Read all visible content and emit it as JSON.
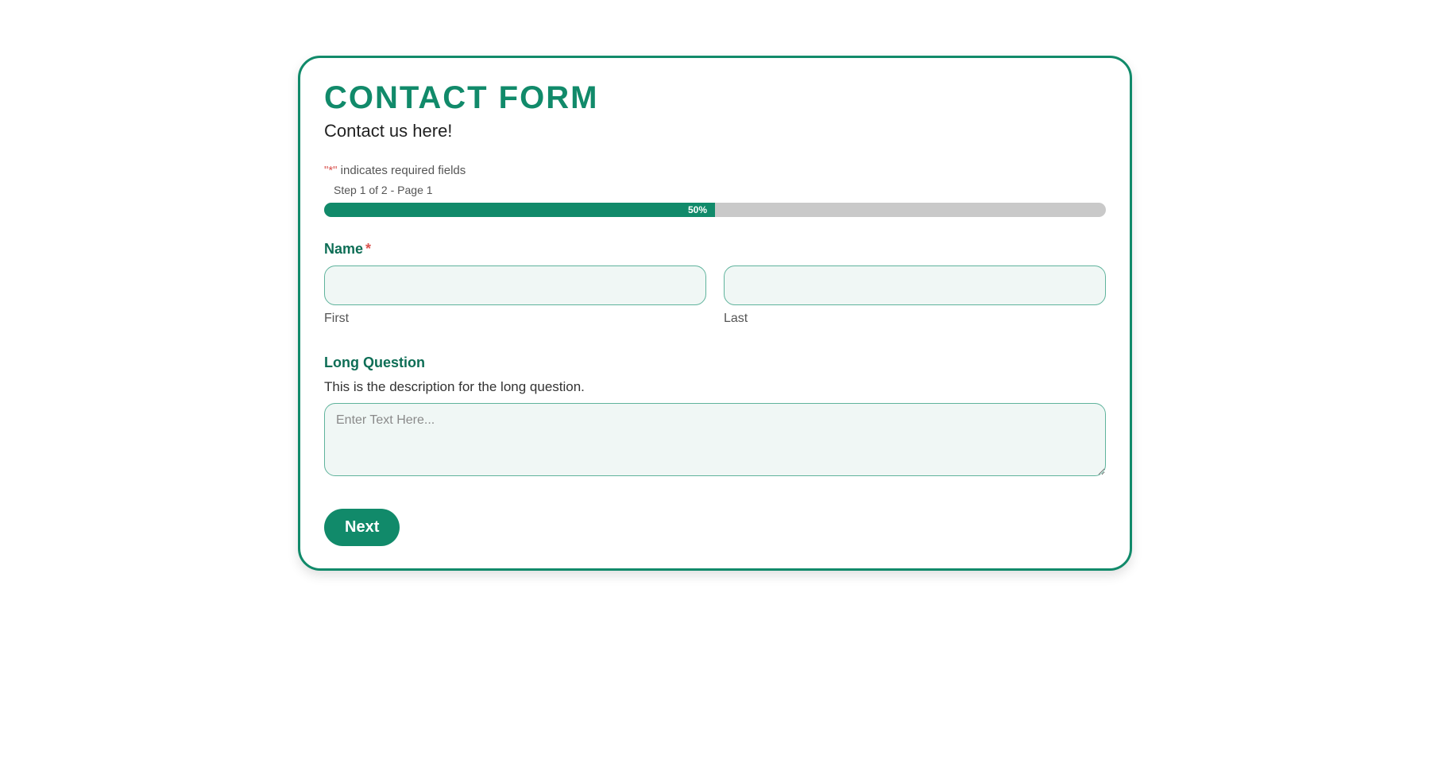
{
  "form": {
    "title": "CONTACT FORM",
    "subtitle": "Contact us here!",
    "required_note_prefix": "\"",
    "required_note_asterisk": "*",
    "required_note_suffix": "\" indicates required fields",
    "step_label": "Step 1 of 2 - Page 1",
    "progress": {
      "percent_text": "50%",
      "percent_value": 50
    },
    "fields": {
      "name": {
        "label": "Name",
        "required_marker": "*",
        "first": {
          "sub_label": "First",
          "value": ""
        },
        "last": {
          "sub_label": "Last",
          "value": ""
        }
      },
      "long_question": {
        "label": "Long Question",
        "description": "This is the description for the long question.",
        "placeholder": "Enter Text Here...",
        "value": ""
      }
    },
    "buttons": {
      "next": "Next"
    }
  }
}
